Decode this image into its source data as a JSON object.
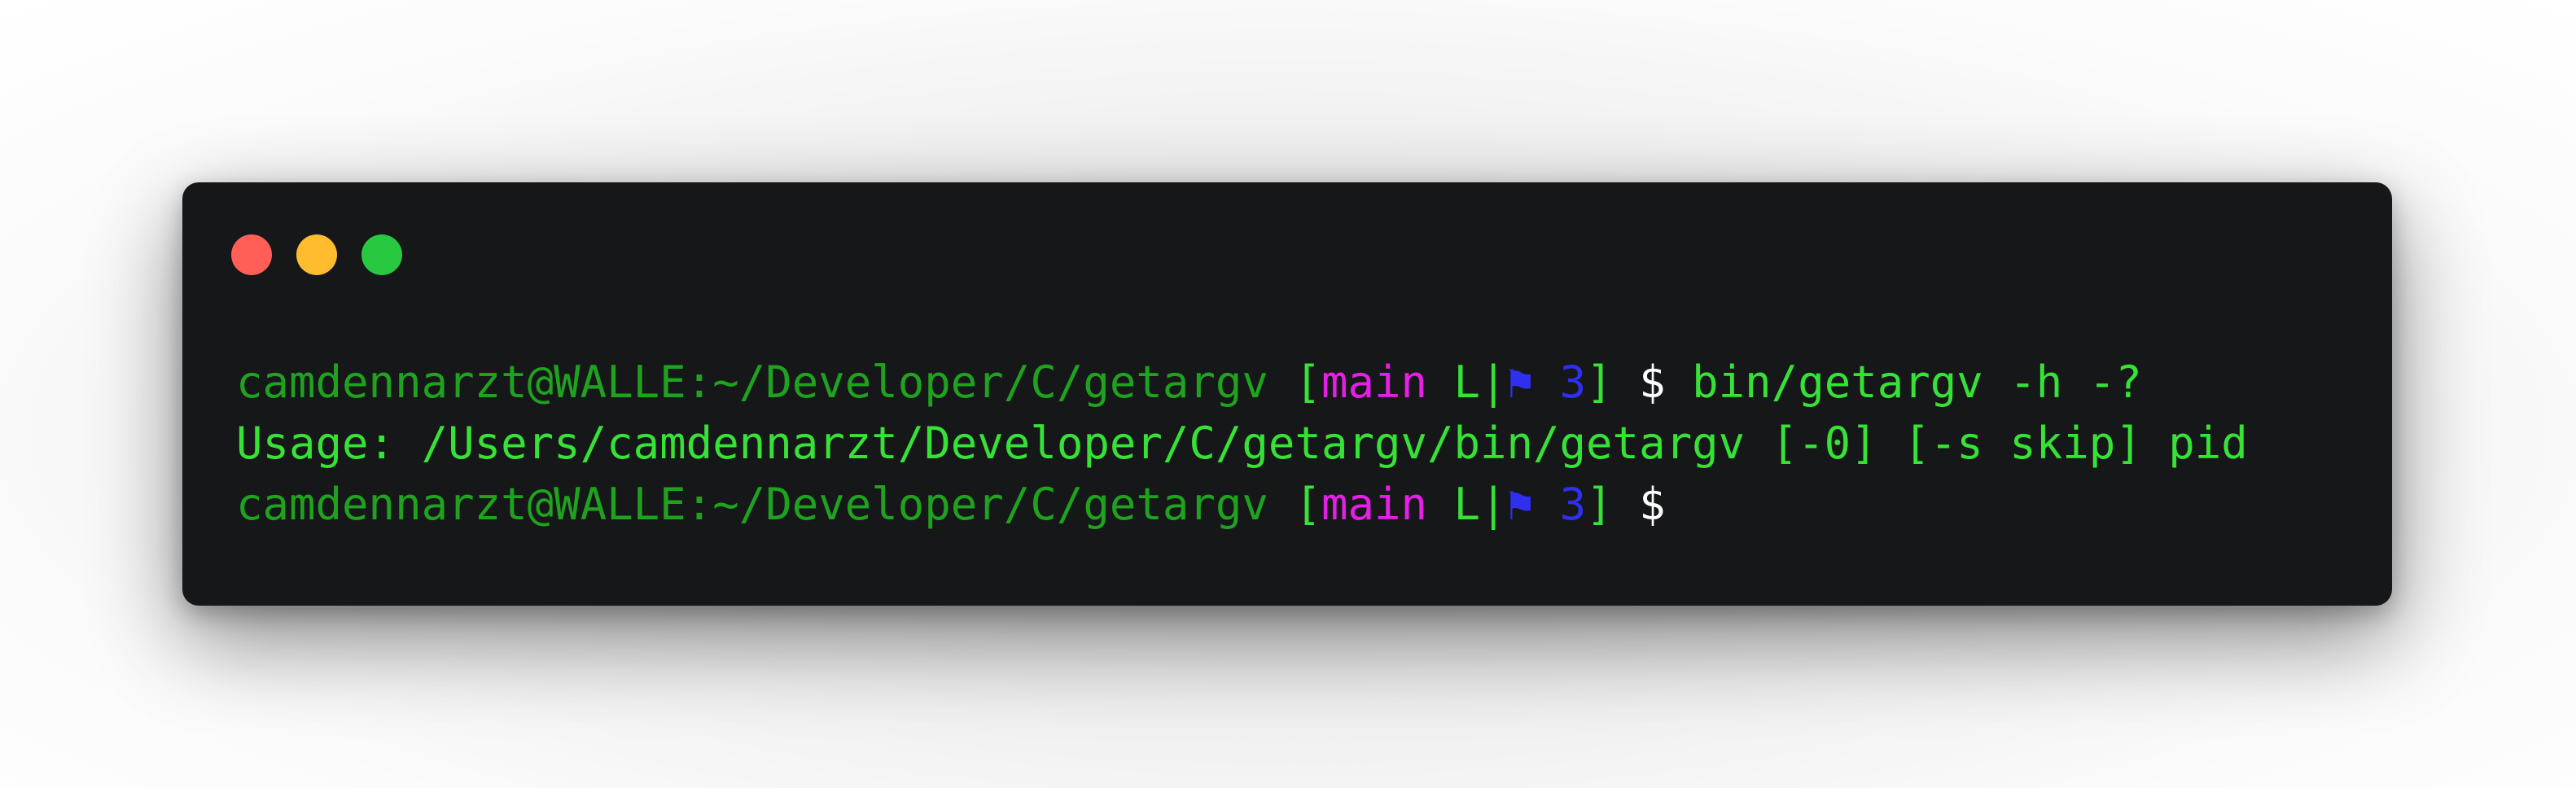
{
  "colors": {
    "window_bg": "#161719",
    "close": "#ff5f57",
    "minimize": "#febc2e",
    "zoom": "#28c840",
    "user_host_path": "#1fa31f",
    "bracket": "#36e236",
    "branch": "#e61ee6",
    "status": "#36e236",
    "flag": "#2f2ff0",
    "count": "#2f2ff0",
    "prompt_symbol": "#ffffff",
    "command": "#36e236",
    "output": "#36e236"
  },
  "window_controls": {
    "close_icon": "close-traffic-light",
    "minimize_icon": "minimize-traffic-light",
    "zoom_icon": "zoom-traffic-light"
  },
  "terminal": {
    "line1": {
      "user_host_path": "camdennarzt@WALLE:~/Developer/C/getargv",
      "bracket_open": " [",
      "branch": "main",
      "status": " L|",
      "flag_icon": "⚑",
      "count": " 3",
      "bracket_close": "]",
      "prompt": " $",
      "command": " bin/getargv -h -?"
    },
    "line2": {
      "output": "Usage: /Users/camdennarzt/Developer/C/getargv/bin/getargv [-0] [-s skip] pid"
    },
    "line3": {
      "user_host_path": "camdennarzt@WALLE:~/Developer/C/getargv",
      "bracket_open": " [",
      "branch": "main",
      "status": " L|",
      "flag_icon": "⚑",
      "count": " 3",
      "bracket_close": "]",
      "prompt": " $"
    }
  }
}
